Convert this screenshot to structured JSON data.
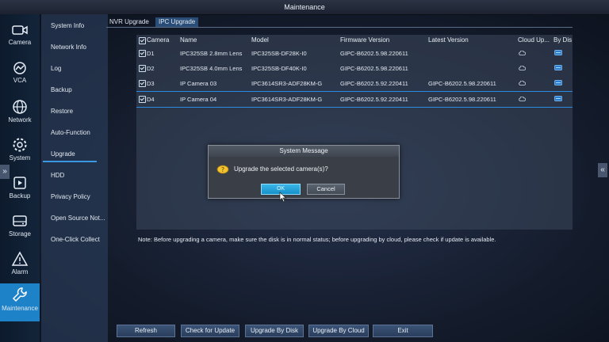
{
  "window": {
    "title": "Maintenance"
  },
  "left_nav": [
    {
      "label": "Camera",
      "icon": "camera-icon"
    },
    {
      "label": "VCA",
      "icon": "vca-icon"
    },
    {
      "label": "Network",
      "icon": "globe-icon"
    },
    {
      "label": "System",
      "icon": "gear-icon"
    },
    {
      "label": "Backup",
      "icon": "backup-icon"
    },
    {
      "label": "Storage",
      "icon": "storage-icon"
    },
    {
      "label": "Alarm",
      "icon": "alarm-icon"
    },
    {
      "label": "Maintenance",
      "icon": "wrench-icon",
      "active": true
    }
  ],
  "sub_nav": [
    "System Info",
    "Network Info",
    "Log",
    "Backup",
    "Restore",
    "Auto-Function",
    "Upgrade",
    "HDD",
    "Privacy Policy",
    "Open Source Not...",
    "One-Click Collect"
  ],
  "tabs": [
    "NVR Upgrade",
    "IPC Upgrade"
  ],
  "table": {
    "headers": [
      "Camera",
      "Name",
      "Model",
      "Firmware Version",
      "Latest Version",
      "Cloud Up...",
      "By Dis"
    ],
    "rows": [
      {
        "camera": "D1",
        "name": "IPC325SB 2.8mm Lens",
        "model": "IPC325SB-DF28K-I0",
        "firmware": "GIPC-B6202.5.98.220611",
        "latest": "",
        "selected": false
      },
      {
        "camera": "D2",
        "name": "IPC325SB 4.0mm Lens",
        "model": "IPC325SB-DF40K-I0",
        "firmware": "GIPC-B6202.5.98.220611",
        "latest": "",
        "selected": false
      },
      {
        "camera": "D3",
        "name": "IP Camera 03",
        "model": "IPC3614SR3-ADF28KM-G",
        "firmware": "GIPC-B6202.5.92.220411",
        "latest": "GIPC-B6202.5.98.220611",
        "selected": false
      },
      {
        "camera": "D4",
        "name": "IP Camera 04",
        "model": "IPC3614SR3-ADF28KM-G",
        "firmware": "GIPC-B6202.5.92.220411",
        "latest": "GIPC-B6202.5.98.220611",
        "selected": true
      }
    ]
  },
  "note": "Note: Before upgrading a camera, make sure the disk is in normal status; before upgrading by cloud, please check if update is available.",
  "bottom_buttons": [
    "Refresh",
    "Check for Update",
    "Upgrade By Disk",
    "Upgrade By Cloud",
    "Exit"
  ],
  "dialog": {
    "title": "System Message",
    "message": "Upgrade the selected camera(s)?",
    "ok": "OK",
    "cancel": "Cancel"
  },
  "colors": {
    "accent": "#1d82c8",
    "ok_button": "#1591c9",
    "selection": "#2b8be0"
  }
}
